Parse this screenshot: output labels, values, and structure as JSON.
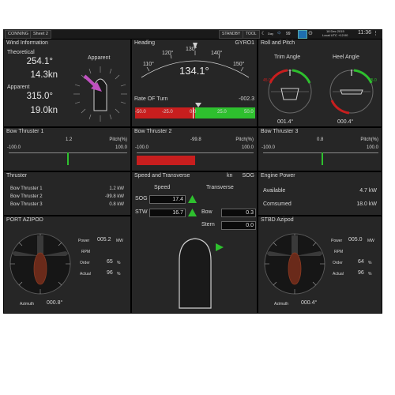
{
  "topbar": {
    "tabs": [
      "CONNING",
      "Sheet 2"
    ],
    "buttons": [
      "STANDBY",
      "TOOL"
    ],
    "day_label": "Day",
    "brightness": "99",
    "date": "18 Dec 2015",
    "local_utc": "Local UTC +12:00",
    "clock": "11:36"
  },
  "wind": {
    "title": "Wind Information",
    "theoretical_label": "Theoretical",
    "theo_dir": "254.1°",
    "theo_speed": "14.3kn",
    "apparent_label": "Apparent",
    "app_dir": "315.0°",
    "app_speed": "19.0kn",
    "apparent_dial_label": "Apparent",
    "arrow_color": "#c050c0"
  },
  "heading": {
    "title": "Heading",
    "source": "GYRO1",
    "value": "134.1°",
    "scale": [
      "110°",
      "120°",
      "130°",
      "140°",
      "150°"
    ],
    "rot_title": "Rate OF Turn",
    "rot_value": "-002.3",
    "rot_scale": [
      "-50.0",
      "-25.0",
      "0.0",
      "25.0",
      "50.0"
    ],
    "rot_level": -2.3
  },
  "roll_pitch": {
    "title": "Roll and Pitch",
    "trim_label": "Trim Angle",
    "heel_label": "Heel Angle",
    "trim_value": "001.4°",
    "heel_value": "000.4°",
    "dial_marks": [
      "45.0",
      "45.0"
    ]
  },
  "thrusters": [
    {
      "title": "Bow Thruster 1",
      "value": "1.2",
      "unit": "Pitch(%)",
      "min": "-100.0",
      "max": "100.0",
      "level": 1.2
    },
    {
      "title": "Bow Thruster 2",
      "value": "-99.8",
      "unit": "Pitch(%)",
      "min": "-100.0",
      "max": "100.0",
      "level": -99.8
    },
    {
      "title": "Bow Thruster 3",
      "value": "0.8",
      "unit": "Pitch(%)",
      "min": "-100.0",
      "max": "100.0",
      "level": 0.8
    }
  ],
  "thruster_list": {
    "title": "Thruster",
    "rows": [
      {
        "name": "Bow Thruster 1",
        "value": "1.2 kW"
      },
      {
        "name": "Bow Thruster 2",
        "value": "-99.8 kW"
      },
      {
        "name": "Bow Thruster 3",
        "value": "0.8 kW"
      }
    ]
  },
  "speed": {
    "title": "Speed and Transverse",
    "unit": "kn",
    "source": "SOG",
    "speed_header": "Speed",
    "transverse_header": "Transverse",
    "sog_label": "SOG",
    "sog_value": "17.4",
    "stw_label": "STW",
    "stw_value": "16.7",
    "bow_label": "Bow",
    "bow_value": "0.3",
    "stern_label": "Stern",
    "stern_value": "0.0",
    "arrow_color": "#2ec02e"
  },
  "engine": {
    "title": "Engine Power",
    "available_label": "Available",
    "available_value": "4.7 kW",
    "consumed_label": "Comsumed",
    "consumed_value": "18.0 kW"
  },
  "port_azipod": {
    "title": "PORT AZIPOD",
    "power_label": "Power",
    "power_value": "005.2",
    "power_unit": "MW",
    "rpm_label": "RPM",
    "order_label": "Order",
    "order_value": "65",
    "actual_label": "Actual",
    "actual_value": "96",
    "pct": "%",
    "azimuth_label": "Azimuth",
    "azimuth_value": "000.8°"
  },
  "stbd_azipod": {
    "title": "STBD Azipod",
    "power_label": "Power",
    "power_value": "005.0",
    "power_unit": "MW",
    "rpm_label": "RPM",
    "order_label": "Order",
    "order_value": "64",
    "actual_label": "Actual",
    "actual_value": "96",
    "pct": "%",
    "azimuth_label": "Azimuth",
    "azimuth_value": "000.4°"
  },
  "colors": {
    "green": "#2ec02e",
    "red": "#c81e1e",
    "pink": "#c050c0"
  }
}
